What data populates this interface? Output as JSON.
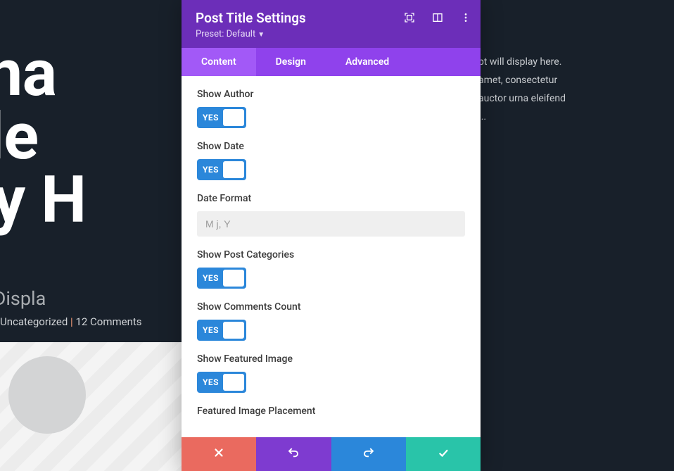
{
  "background": {
    "title_line1": "r Dyna",
    "title_line2": "t Title",
    "title_line3": "splay H",
    "subtitle": "Post Title Will Displa",
    "meta_category": "Uncategorized",
    "meta_sep": " | ",
    "meta_comments": "12 Comments",
    "right_l1": "pt will display here.",
    "right_l2": "amet, consectetur",
    "right_l3": "auctor urna eleifend",
    "right_l4": "..."
  },
  "modal": {
    "title": "Post Title Settings",
    "preset": "Preset: Default",
    "tabs": {
      "content": "Content",
      "design": "Design",
      "advanced": "Advanced"
    },
    "fields": {
      "show_author": "Show Author",
      "show_date": "Show Date",
      "date_format": "Date Format",
      "date_format_placeholder": "M j, Y",
      "show_categories": "Show Post Categories",
      "show_comments": "Show Comments Count",
      "show_featured": "Show Featured Image",
      "featured_placement": "Featured Image Placement",
      "yes": "YES"
    }
  }
}
